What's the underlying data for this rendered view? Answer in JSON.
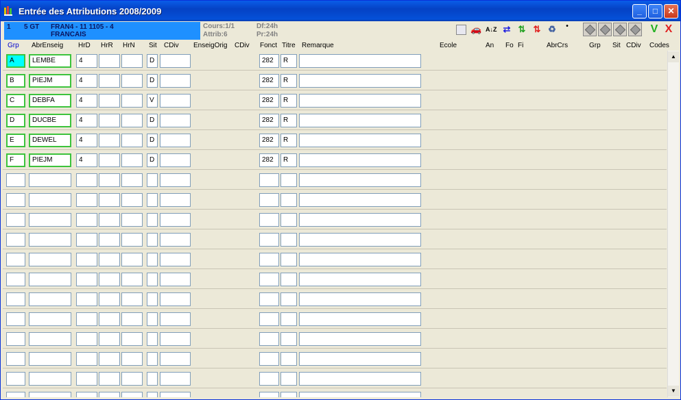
{
  "window": {
    "title": "Entrée des Attributions 2008/2009",
    "controls": {
      "minimize": "_",
      "maximize": "□",
      "close": "✕"
    }
  },
  "info": {
    "num": "1",
    "level": "5 GT",
    "course_code": "FRAN4 - 11 1105  - 4",
    "course_name": "FRANCAIS",
    "cours": "Cours:1/1",
    "attrib": "Attrib:6",
    "df": "Df:24h",
    "pr": "Pr:24h"
  },
  "toolbar": {
    "sort_icon": "A↓Z",
    "confirm": "V",
    "cancel": "X"
  },
  "columns": [
    "Grp",
    "AbrEnseig",
    "HrD",
    "HrR",
    "HrN",
    "Sit",
    "CDiv",
    "EnseigOrig",
    "CDiv",
    "Fonct",
    "Titre",
    "Remarque",
    "Ecole",
    "An",
    "Fo",
    "Fi",
    "AbrCrs",
    "Grp",
    "Sit",
    "CDiv",
    "Codes"
  ],
  "rows": [
    {
      "grp": "A",
      "abr": "LEMBE",
      "hrd": "4",
      "hrr": "",
      "hrn": "",
      "sit": "D",
      "cdiv": "",
      "fonct": "282",
      "titre": "R",
      "rem": ""
    },
    {
      "grp": "B",
      "abr": "PIEJM",
      "hrd": "4",
      "hrr": "",
      "hrn": "",
      "sit": "D",
      "cdiv": "",
      "fonct": "282",
      "titre": "R",
      "rem": ""
    },
    {
      "grp": "C",
      "abr": "DEBFA",
      "hrd": "4",
      "hrr": "",
      "hrn": "",
      "sit": "V",
      "cdiv": "",
      "fonct": "282",
      "titre": "R",
      "rem": ""
    },
    {
      "grp": "D",
      "abr": "DUCBE",
      "hrd": "4",
      "hrr": "",
      "hrn": "",
      "sit": "D",
      "cdiv": "",
      "fonct": "282",
      "titre": "R",
      "rem": ""
    },
    {
      "grp": "E",
      "abr": "DEWEL",
      "hrd": "4",
      "hrr": "",
      "hrn": "",
      "sit": "D",
      "cdiv": "",
      "fonct": "282",
      "titre": "R",
      "rem": ""
    },
    {
      "grp": "F",
      "abr": "PIEJM",
      "hrd": "4",
      "hrr": "",
      "hrn": "",
      "sit": "D",
      "cdiv": "",
      "fonct": "282",
      "titre": "R",
      "rem": ""
    },
    {
      "grp": "",
      "abr": "",
      "hrd": "",
      "hrr": "",
      "hrn": "",
      "sit": "",
      "cdiv": "",
      "fonct": "",
      "titre": "",
      "rem": ""
    },
    {
      "grp": "",
      "abr": "",
      "hrd": "",
      "hrr": "",
      "hrn": "",
      "sit": "",
      "cdiv": "",
      "fonct": "",
      "titre": "",
      "rem": ""
    },
    {
      "grp": "",
      "abr": "",
      "hrd": "",
      "hrr": "",
      "hrn": "",
      "sit": "",
      "cdiv": "",
      "fonct": "",
      "titre": "",
      "rem": ""
    },
    {
      "grp": "",
      "abr": "",
      "hrd": "",
      "hrr": "",
      "hrn": "",
      "sit": "",
      "cdiv": "",
      "fonct": "",
      "titre": "",
      "rem": ""
    },
    {
      "grp": "",
      "abr": "",
      "hrd": "",
      "hrr": "",
      "hrn": "",
      "sit": "",
      "cdiv": "",
      "fonct": "",
      "titre": "",
      "rem": ""
    },
    {
      "grp": "",
      "abr": "",
      "hrd": "",
      "hrr": "",
      "hrn": "",
      "sit": "",
      "cdiv": "",
      "fonct": "",
      "titre": "",
      "rem": ""
    },
    {
      "grp": "",
      "abr": "",
      "hrd": "",
      "hrr": "",
      "hrn": "",
      "sit": "",
      "cdiv": "",
      "fonct": "",
      "titre": "",
      "rem": ""
    },
    {
      "grp": "",
      "abr": "",
      "hrd": "",
      "hrr": "",
      "hrn": "",
      "sit": "",
      "cdiv": "",
      "fonct": "",
      "titre": "",
      "rem": ""
    },
    {
      "grp": "",
      "abr": "",
      "hrd": "",
      "hrr": "",
      "hrn": "",
      "sit": "",
      "cdiv": "",
      "fonct": "",
      "titre": "",
      "rem": ""
    },
    {
      "grp": "",
      "abr": "",
      "hrd": "",
      "hrr": "",
      "hrn": "",
      "sit": "",
      "cdiv": "",
      "fonct": "",
      "titre": "",
      "rem": ""
    },
    {
      "grp": "",
      "abr": "",
      "hrd": "",
      "hrr": "",
      "hrn": "",
      "sit": "",
      "cdiv": "",
      "fonct": "",
      "titre": "",
      "rem": ""
    },
    {
      "grp": "",
      "abr": "",
      "hrd": "",
      "hrr": "",
      "hrn": "",
      "sit": "",
      "cdiv": "",
      "fonct": "",
      "titre": "",
      "rem": ""
    }
  ],
  "colors": {
    "title_bar": "#0a5de8",
    "info_box": "#1e90ff",
    "active_border": "#3cc33c",
    "selected_cell": "#00ffff"
  }
}
